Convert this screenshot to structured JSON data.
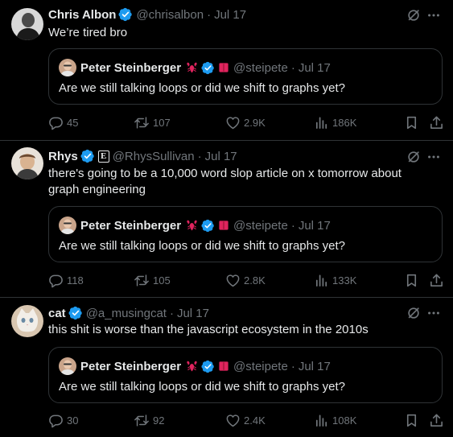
{
  "icons": {
    "verified": "verified-badge-icon",
    "grok": "grok-icon",
    "more": "more-options-icon",
    "reply": "reply-icon",
    "retweet": "retweet-icon",
    "like": "like-icon",
    "views": "views-icon",
    "bookmark": "bookmark-icon",
    "share": "share-icon"
  },
  "colors": {
    "verified": "#1d9bf0",
    "muted": "#71767b",
    "text": "#e7e9ea",
    "border": "#2f3336",
    "background": "#000000"
  },
  "tweets": [
    {
      "name": "Chris Albon",
      "handle": "@chrisalbon",
      "separator": "·",
      "date": "Jul 17",
      "text": "We’re tired bro",
      "quote": {
        "name": "Peter Steinberger",
        "handle": "@steipete",
        "separator": "·",
        "date": "Jul 17",
        "text": "Are we still talking loops or did we shift to graphs yet?"
      },
      "stats": {
        "replies": "45",
        "retweets": "107",
        "likes": "2.9K",
        "views": "186K"
      }
    },
    {
      "name": "Rhys",
      "affiliation_badge": "E",
      "handle": "@RhysSullivan",
      "separator": "·",
      "date": "Jul 17",
      "text": "there's going to be a 10,000 word slop article on x tomorrow about graph engineering",
      "quote": {
        "name": "Peter Steinberger",
        "handle": "@steipete",
        "separator": "·",
        "date": "Jul 17",
        "text": "Are we still talking loops or did we shift to graphs yet?"
      },
      "stats": {
        "replies": "118",
        "retweets": "105",
        "likes": "2.8K",
        "views": "133K"
      }
    },
    {
      "name": "cat",
      "handle": "@a_musingcat",
      "separator": "·",
      "date": "Jul 17",
      "text": "this shit is worse than the javascript ecosystem in the 2010s",
      "quote": {
        "name": "Peter Steinberger",
        "handle": "@steipete",
        "separator": "·",
        "date": "Jul 17",
        "text": "Are we still talking loops or did we shift to graphs yet?"
      },
      "stats": {
        "replies": "30",
        "retweets": "92",
        "likes": "2.4K",
        "views": "108K"
      }
    }
  ]
}
